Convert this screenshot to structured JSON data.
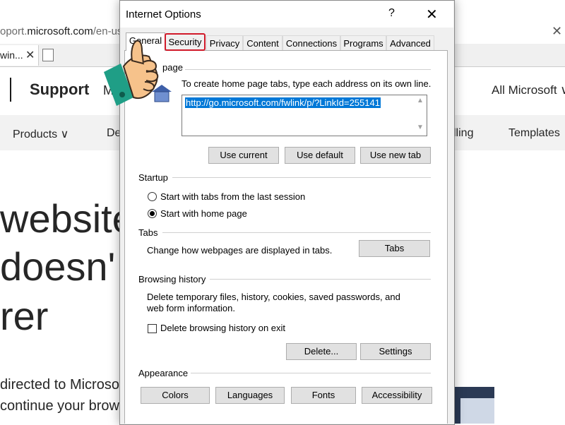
{
  "browser": {
    "address": {
      "prefix": "oport.",
      "domain": "microsoft.com",
      "suffix": "/en-us"
    },
    "tab_label": "win...",
    "site": {
      "brand": "Support",
      "menu_letter": "M",
      "all_microsoft": "All Microsoft ∨"
    },
    "nav": {
      "products": "Products ∨",
      "de": "De",
      "lling": "lling",
      "templates": "Templates"
    },
    "hero_lines": [
      "website y",
      " doesn'",
      "rer"
    ],
    "body_lines": [
      "directed to Microsof",
      "continue your brows"
    ]
  },
  "dialog": {
    "title": "Internet Options",
    "help": "?",
    "close": "✕",
    "tabs": [
      "General",
      "Security",
      "Privacy",
      "Content",
      "Connections",
      "Programs",
      "Advanced"
    ],
    "home_page": {
      "label": "page",
      "instructions": "To create home page tabs, type each address on its own line.",
      "url": "http://go.microsoft.com/fwlink/p/?LinkId=255141",
      "buttons": {
        "use_current": "Use current",
        "use_default": "Use default",
        "use_new_tab": "Use new tab"
      }
    },
    "startup": {
      "label": "Startup",
      "option_last_session": "Start with tabs from the last session",
      "option_home_page": "Start with home page",
      "selected": "home_page"
    },
    "tabs_group": {
      "label": "Tabs",
      "description": "Change how webpages are displayed in tabs.",
      "button": "Tabs"
    },
    "browsing_history": {
      "label": "Browsing history",
      "description_line1": "Delete temporary files, history, cookies, saved passwords, and",
      "description_line2": "web form information.",
      "checkbox_label": "Delete browsing history on exit",
      "checkbox_checked": false,
      "delete_button": "Delete...",
      "settings_button": "Settings"
    },
    "appearance": {
      "label": "Appearance",
      "buttons": {
        "colors": "Colors",
        "languages": "Languages",
        "fonts": "Fonts",
        "accessibility": "Accessibility"
      }
    }
  },
  "colors": {
    "highlight": "#d11a2a",
    "selection": "#0078d7"
  },
  "icons": {
    "hand": "pointing-hand-icon",
    "home": "home-icon"
  }
}
